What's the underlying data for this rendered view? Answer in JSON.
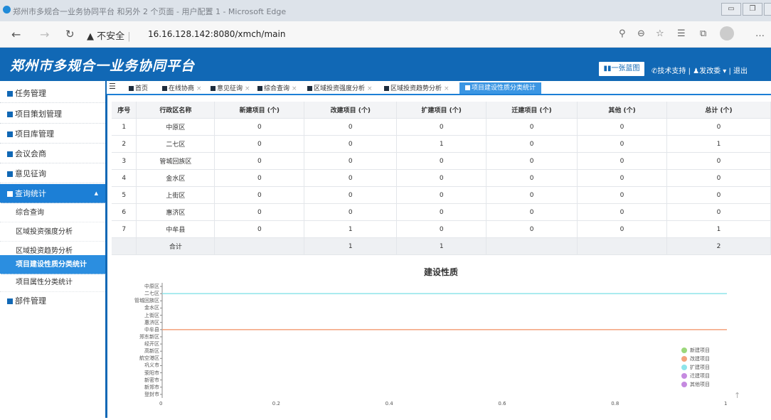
{
  "browser": {
    "window_title": "郑州市多规合一业务协同平台 和另外 2 个页面 - 用户配置 1 - Microsoft Edge",
    "security_label": "不安全",
    "url": "16.16.128.142:8080/xmch/main"
  },
  "header": {
    "title": "郑州市多规合一业务协同平台",
    "map_button": "一张蓝图",
    "support": "技术支持",
    "user": "发改委",
    "logout": "退出"
  },
  "sidebar": {
    "items": [
      {
        "label": "任务管理"
      },
      {
        "label": "项目策划管理"
      },
      {
        "label": "项目库管理"
      },
      {
        "label": "会议会商"
      },
      {
        "label": "意见征询"
      },
      {
        "label": "查询统计"
      },
      {
        "label": "部件管理"
      }
    ],
    "sub_items": [
      {
        "label": "综合查询"
      },
      {
        "label": "区域投资强度分析"
      },
      {
        "label": "区域投资趋势分析"
      },
      {
        "label": "项目建设性质分类统计"
      },
      {
        "label": "项目属性分类统计"
      }
    ]
  },
  "tabs": [
    {
      "label": "首页"
    },
    {
      "label": "在线协商"
    },
    {
      "label": "意见征询"
    },
    {
      "label": "综合查询"
    },
    {
      "label": "区域投资强度分析"
    },
    {
      "label": "区域投资趋势分析"
    },
    {
      "label": "项目建设性质分类统计"
    }
  ],
  "table": {
    "headers": [
      "序号",
      "行政区名称",
      "新建项目 (个)",
      "改建项目 (个)",
      "扩建项目 (个)",
      "迁建项目 (个)",
      "其他 (个)",
      "总计 (个)"
    ],
    "rows": [
      [
        "1",
        "中原区",
        "0",
        "0",
        "0",
        "0",
        "0",
        "0"
      ],
      [
        "2",
        "二七区",
        "0",
        "0",
        "1",
        "0",
        "0",
        "1"
      ],
      [
        "3",
        "管城回族区",
        "0",
        "0",
        "0",
        "0",
        "0",
        "0"
      ],
      [
        "4",
        "金水区",
        "0",
        "0",
        "0",
        "0",
        "0",
        "0"
      ],
      [
        "5",
        "上街区",
        "0",
        "0",
        "0",
        "0",
        "0",
        "0"
      ],
      [
        "6",
        "惠济区",
        "0",
        "0",
        "0",
        "0",
        "0",
        "0"
      ],
      [
        "7",
        "中牟县",
        "0",
        "1",
        "0",
        "0",
        "0",
        "1"
      ],
      [
        "",
        "合计",
        "",
        "1",
        "1",
        "",
        "",
        "2"
      ]
    ]
  },
  "chart_data": {
    "type": "bar",
    "orientation": "horizontal",
    "title": "建设性质",
    "categories": [
      "中原区",
      "二七区",
      "管城回族区",
      "金水区",
      "上街区",
      "惠济区",
      "中牟县",
      "郑东新区",
      "经开区",
      "高新区",
      "航空港区",
      "巩义市",
      "荥阳市",
      "新密市",
      "新郑市",
      "登封市"
    ],
    "xlim": [
      0,
      1
    ],
    "xticks": [
      "0",
      "0.2",
      "0.4",
      "0.6",
      "0.8",
      "1"
    ],
    "series": [
      {
        "name": "新建项目",
        "color": "#9bd77a",
        "values": [
          0,
          0,
          0,
          0,
          0,
          0,
          0,
          0,
          0,
          0,
          0,
          0,
          0,
          0,
          0,
          0
        ]
      },
      {
        "name": "改建项目",
        "color": "#f4a27c",
        "values": [
          0,
          0,
          0,
          0,
          0,
          0,
          1,
          0,
          0,
          0,
          0,
          0,
          0,
          0,
          0,
          0
        ]
      },
      {
        "name": "扩建项目",
        "color": "#8fe4ea",
        "values": [
          0,
          1,
          0,
          0,
          0,
          0,
          0,
          0,
          0,
          0,
          0,
          0,
          0,
          0,
          0,
          0
        ]
      },
      {
        "name": "迁建项目",
        "color": "#c58ae0",
        "values": [
          0,
          0,
          0,
          0,
          0,
          0,
          0,
          0,
          0,
          0,
          0,
          0,
          0,
          0,
          0,
          0
        ]
      },
      {
        "name": "其他项目",
        "color": "#c58ae0",
        "values": [
          0,
          0,
          0,
          0,
          0,
          0,
          0,
          0,
          0,
          0,
          0,
          0,
          0,
          0,
          0,
          0
        ]
      }
    ],
    "legend": "bottom-right"
  },
  "colors": {
    "header_blue": "#1168b5",
    "active_blue": "#1c7fd6"
  }
}
